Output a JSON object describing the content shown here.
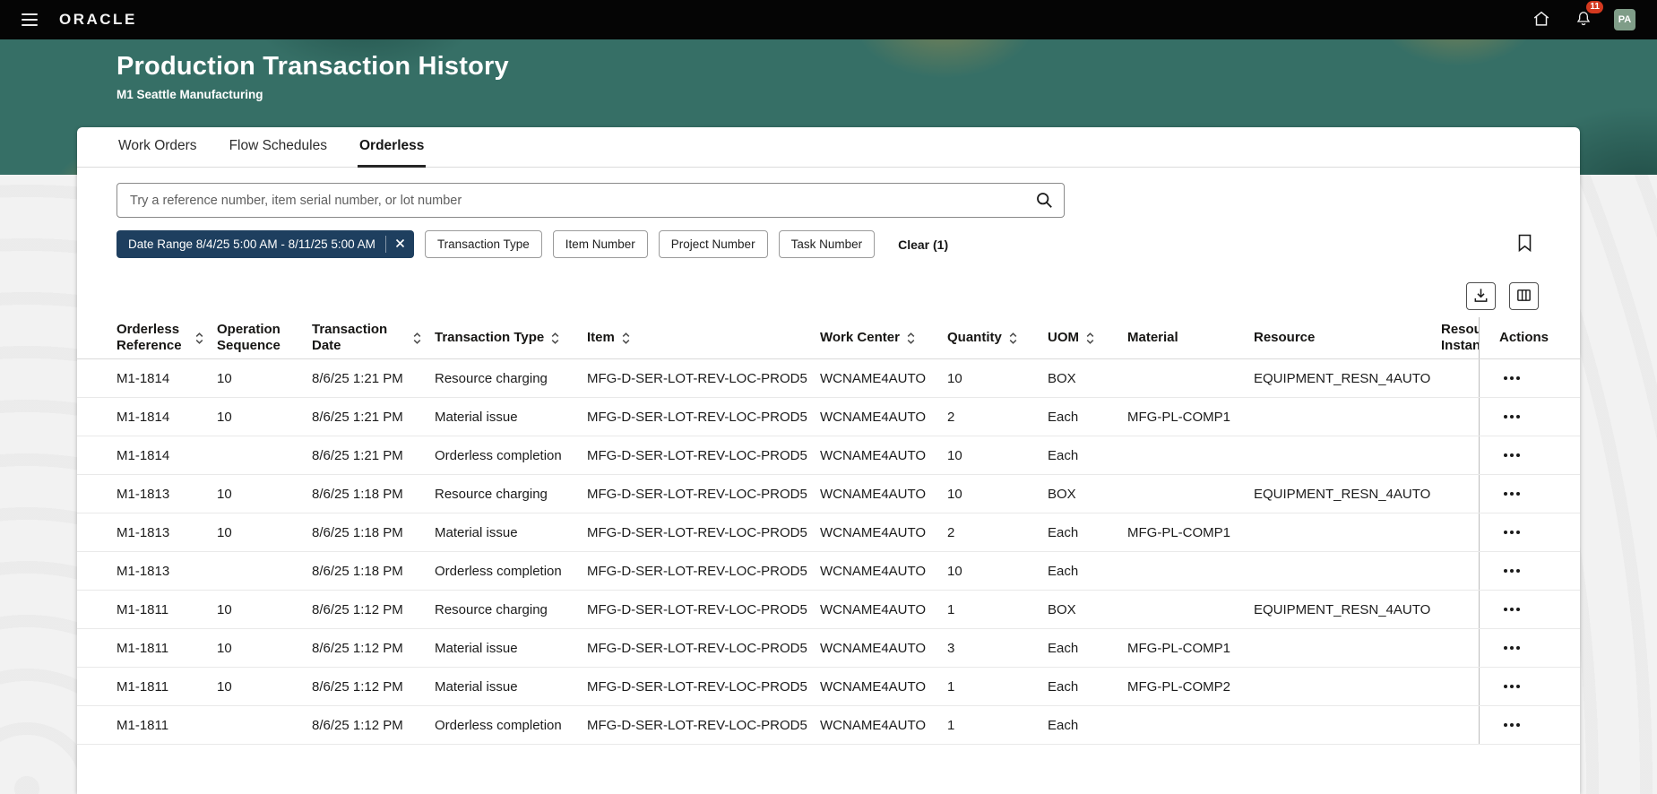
{
  "topbar": {
    "brand": "ORACLE",
    "notification_count": "11",
    "avatar_initials": "PA"
  },
  "header": {
    "title": "Production Transaction History",
    "subtitle": "M1 Seattle Manufacturing"
  },
  "tabs": [
    {
      "label": "Work Orders",
      "active": false
    },
    {
      "label": "Flow Schedules",
      "active": false
    },
    {
      "label": "Orderless",
      "active": true
    }
  ],
  "search": {
    "placeholder": "Try a reference number, item serial number, or lot number"
  },
  "filters": {
    "date_chip_label": "Date Range 8/4/25 5:00 AM - 8/11/25 5:00 AM",
    "chips": [
      "Transaction Type",
      "Item Number",
      "Project Number",
      "Task Number"
    ],
    "clear_label": "Clear (1)"
  },
  "icons": {
    "menu-icon": "hamburger-lines",
    "home-icon": "house-outline",
    "notifications-icon": "bell-outline",
    "search-icon": "magnifier",
    "close-icon": "x",
    "bookmark-icon": "bookmark-outline",
    "download-icon": "download-tray",
    "manage-columns-icon": "column-grid",
    "sort-icon": "up-down-chevrons",
    "row-actions-icon": "ellipsis"
  },
  "colors": {
    "topbar_bg": "#050505",
    "banner_teal": "#366f66",
    "banner_accent_orange": "#e2a03e",
    "chip_selected": "#1e3f5f",
    "badge_red": "#d4391f"
  },
  "table": {
    "columns": [
      {
        "label": "Orderless Reference",
        "sortable": true
      },
      {
        "label": "Operation Sequence",
        "sortable": false
      },
      {
        "label": "Transaction Date",
        "sortable": true
      },
      {
        "label": "Transaction Type",
        "sortable": true
      },
      {
        "label": "Item",
        "sortable": true
      },
      {
        "label": "Work Center",
        "sortable": true
      },
      {
        "label": "Quantity",
        "sortable": true
      },
      {
        "label": "UOM",
        "sortable": true
      },
      {
        "label": "Material",
        "sortable": false
      },
      {
        "label": "Resource",
        "sortable": false
      },
      {
        "label": "Resource Instance",
        "sortable": false
      },
      {
        "label": "Actions",
        "sortable": false
      }
    ],
    "rows": [
      [
        "M1-1814",
        "10",
        "8/6/25 1:21 PM",
        "Resource charging",
        "MFG-D-SER-LOT-REV-LOC-PROD5",
        "WCNAME4AUTO",
        "10",
        "BOX",
        "",
        "EQUIPMENT_RESN_4AUTO",
        ""
      ],
      [
        "M1-1814",
        "10",
        "8/6/25 1:21 PM",
        "Material issue",
        "MFG-D-SER-LOT-REV-LOC-PROD5",
        "WCNAME4AUTO",
        "2",
        "Each",
        "MFG-PL-COMP1",
        "",
        ""
      ],
      [
        "M1-1814",
        "",
        "8/6/25 1:21 PM",
        "Orderless completion",
        "MFG-D-SER-LOT-REV-LOC-PROD5",
        "WCNAME4AUTO",
        "10",
        "Each",
        "",
        "",
        ""
      ],
      [
        "M1-1813",
        "10",
        "8/6/25 1:18 PM",
        "Resource charging",
        "MFG-D-SER-LOT-REV-LOC-PROD5",
        "WCNAME4AUTO",
        "10",
        "BOX",
        "",
        "EQUIPMENT_RESN_4AUTO",
        ""
      ],
      [
        "M1-1813",
        "10",
        "8/6/25 1:18 PM",
        "Material issue",
        "MFG-D-SER-LOT-REV-LOC-PROD5",
        "WCNAME4AUTO",
        "2",
        "Each",
        "MFG-PL-COMP1",
        "",
        ""
      ],
      [
        "M1-1813",
        "",
        "8/6/25 1:18 PM",
        "Orderless completion",
        "MFG-D-SER-LOT-REV-LOC-PROD5",
        "WCNAME4AUTO",
        "10",
        "Each",
        "",
        "",
        ""
      ],
      [
        "M1-1811",
        "10",
        "8/6/25 1:12 PM",
        "Resource charging",
        "MFG-D-SER-LOT-REV-LOC-PROD5",
        "WCNAME4AUTO",
        "1",
        "BOX",
        "",
        "EQUIPMENT_RESN_4AUTO",
        ""
      ],
      [
        "M1-1811",
        "10",
        "8/6/25 1:12 PM",
        "Material issue",
        "MFG-D-SER-LOT-REV-LOC-PROD5",
        "WCNAME4AUTO",
        "3",
        "Each",
        "MFG-PL-COMP1",
        "",
        ""
      ],
      [
        "M1-1811",
        "10",
        "8/6/25 1:12 PM",
        "Material issue",
        "MFG-D-SER-LOT-REV-LOC-PROD5",
        "WCNAME4AUTO",
        "1",
        "Each",
        "MFG-PL-COMP2",
        "",
        ""
      ],
      [
        "M1-1811",
        "",
        "8/6/25 1:12 PM",
        "Orderless completion",
        "MFG-D-SER-LOT-REV-LOC-PROD5",
        "WCNAME4AUTO",
        "1",
        "Each",
        "",
        "",
        ""
      ]
    ]
  }
}
